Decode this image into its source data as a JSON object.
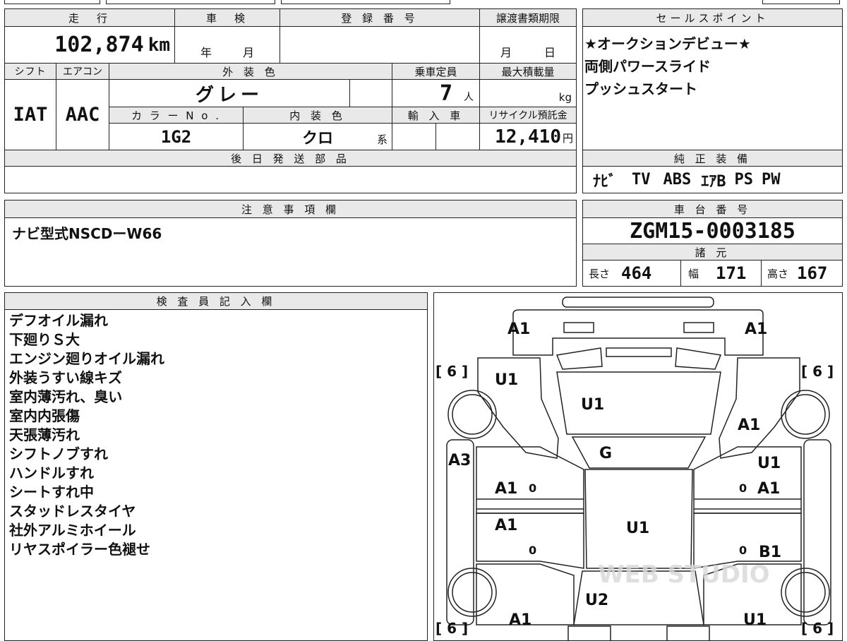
{
  "headers": {
    "mileage": "走　行",
    "inspection": "車　検",
    "registration": "登 録 番 号",
    "transfer_deadline": "譲渡書類期限",
    "sales_points": "セールスポイント",
    "shift": "シフト",
    "aircon": "エアコン",
    "exterior_color": "外 装 色",
    "capacity": "乗車定員",
    "max_load": "最大積載量",
    "color_no": "カ ラ ー N o .",
    "interior_color": "内 装 色",
    "import": "輸 入 車",
    "recycle_fee": "リサイクル預託金",
    "later_parts": "後 日 発 送 部 品",
    "genuine_equipment": "純 正 装 備",
    "notes": "注 意 事 項 欄",
    "chassis_no": "車 台 番 号",
    "specs": "諸 元",
    "inspector": "検 査 員 記 入 欄"
  },
  "vehicle": {
    "mileage_value": "102,874",
    "mileage_unit": "km",
    "inspection_year": "年",
    "inspection_month": "月",
    "deadline_month": "月",
    "deadline_day": "日",
    "shift": "IAT",
    "aircon": "AAC",
    "exterior_color": "グレー",
    "capacity": "7",
    "capacity_unit": "人",
    "max_load_unit": "kg",
    "color_no": "1G2",
    "interior_color": "クロ",
    "interior_suffix": "系",
    "recycle_fee": "12,410",
    "recycle_unit": "円",
    "chassis_no": "ZGM15-0003185",
    "length_label": "長さ",
    "length": "464",
    "width_label": "幅",
    "width": "171",
    "height_label": "高さ",
    "height": "167"
  },
  "sales_points": [
    "★オークションデビュー★",
    "両側パワースライド",
    "プッシュスタート"
  ],
  "equipment": [
    "ﾅﾋﾞ",
    "TV",
    "ABS",
    "ｴｱB",
    "PS",
    "PW"
  ],
  "notes_text": "ナビ型式NSCDーW66",
  "inspector_notes": [
    "デフオイル漏れ",
    "下廻りＳ大",
    "エンジン廻りオイル漏れ",
    "外装うすい線キズ",
    "室内薄汚れ、臭い",
    "室内内張傷",
    "天張薄汚れ",
    "シフトノブすれ",
    "ハンドルすれ",
    "シートすれ中",
    "スタッドレスタイヤ",
    "社外アルミホイール",
    "リヤスポイラー色褪せ"
  ],
  "diagram": {
    "tire_label": "[ 6 ]",
    "zero": "0",
    "front_left": "A1",
    "front_right": "A1",
    "fender_left": "U1",
    "hood": "U1",
    "fender_right": "A1",
    "windshield": "G",
    "pillar_left": "A3",
    "front_door_right_top": "U1",
    "front_door_left": "A1",
    "front_door_right": "A1",
    "rear_door_left": "A1",
    "roof": "U1",
    "rear_door_right": "B1",
    "rear_glass": "U2",
    "rear_left": "A1",
    "rear_right": "U1",
    "watermark": "WEB STUDIO"
  }
}
